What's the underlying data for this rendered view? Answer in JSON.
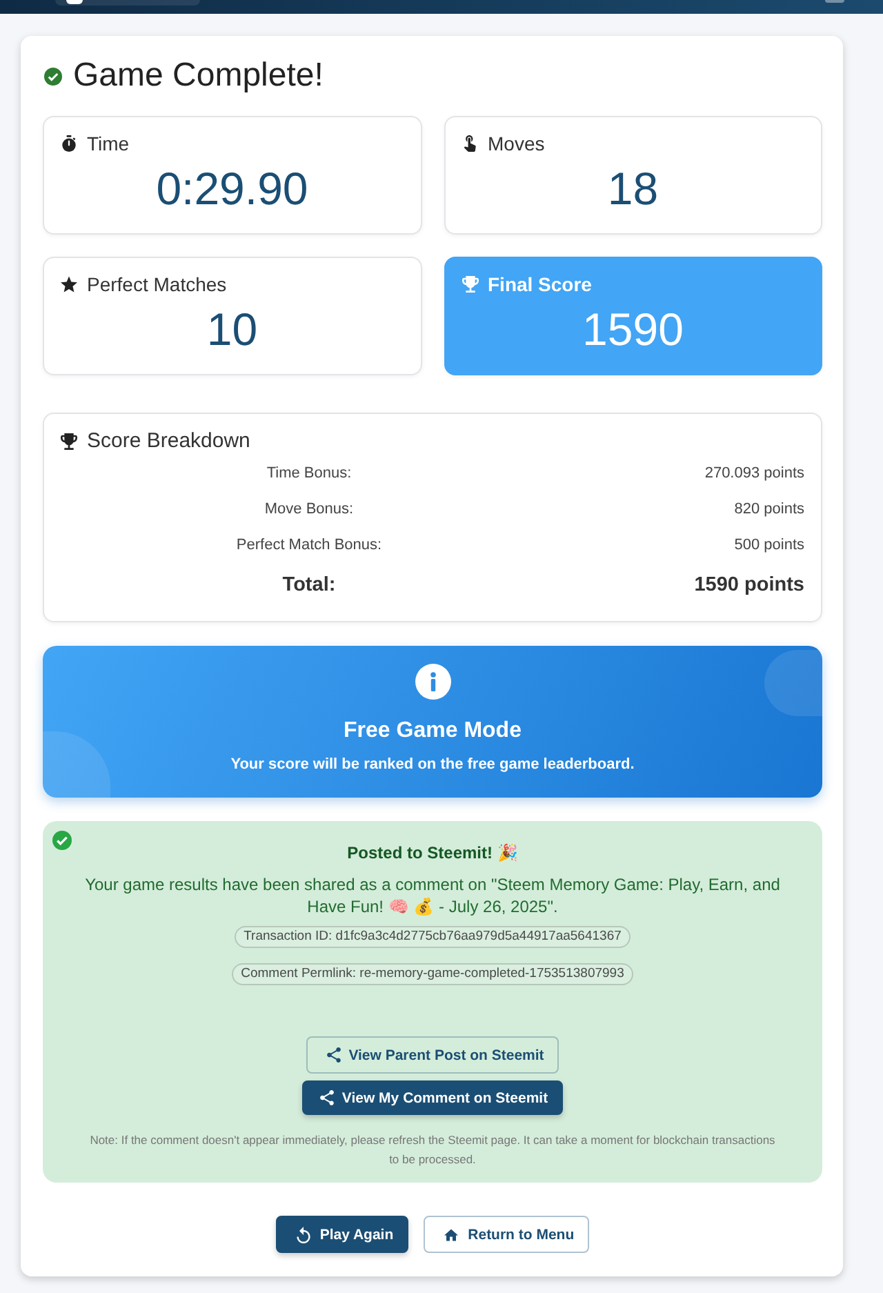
{
  "title": "Game Complete!",
  "stats": [
    {
      "kind": "time",
      "label": "Time",
      "value": "0:29.90",
      "highlighted": false
    },
    {
      "kind": "moves",
      "label": "Moves",
      "value": "18",
      "highlighted": false
    },
    {
      "kind": "perfect",
      "label": "Perfect Matches",
      "value": "10",
      "highlighted": false
    },
    {
      "kind": "score",
      "label": "Final Score",
      "value": "1590",
      "highlighted": true
    }
  ],
  "score_breakdown": {
    "title": "Score Breakdown",
    "rows": [
      {
        "kind": "item",
        "label": "Time Bonus:",
        "value": "270.093 points"
      },
      {
        "kind": "item",
        "label": "Move Bonus:",
        "value": "820 points"
      },
      {
        "kind": "item",
        "label": "Perfect Match Bonus:",
        "value": "500 points"
      },
      {
        "kind": "total",
        "label": "Total:",
        "value": "1590 points"
      }
    ]
  },
  "mode_banner": {
    "title": "Free Game Mode",
    "message": "Your score will be ranked on the free game leaderboard."
  },
  "post_status": {
    "title": "Posted to Steemit! 🎉",
    "message": "Your game results have been shared as a comment on \"Steem Memory Game: Play, Earn, and Have Fun! 🧠 💰 - July 26, 2025\".",
    "details": [
      "Transaction ID: d1fc9a3c4d2775cb76aa979d5a44917aa5641367",
      "Comment Permlink: re-memory-game-completed-1753513807993"
    ],
    "links": [
      {
        "label": "View Parent Post on Steemit",
        "primary": false
      },
      {
        "label": "View My Comment on Steemit",
        "primary": true
      }
    ],
    "note": "Note: If the comment doesn't appear immediately, please refresh the Steemit page. It can take a moment for blockchain transactions to be processed."
  },
  "actions": [
    {
      "kind": "replay",
      "label": "Play Again",
      "primary": true
    },
    {
      "kind": "home",
      "label": "Return to Menu",
      "primary": false
    }
  ]
}
